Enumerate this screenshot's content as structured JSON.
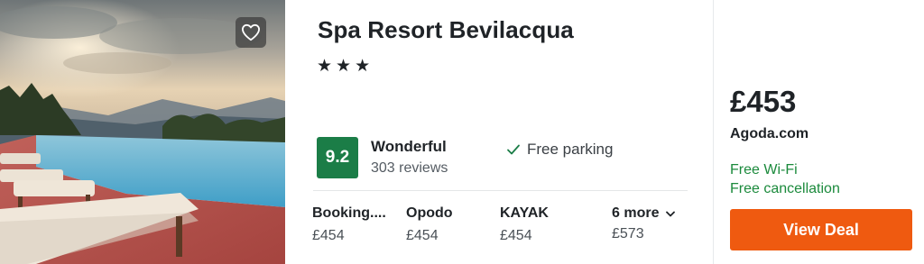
{
  "hotel": {
    "name": "Spa Resort Bevilacqua",
    "stars": "★★★",
    "score": "9.2",
    "rating_word": "Wonderful",
    "reviews": "303 reviews",
    "amenity": "Free parking"
  },
  "partners": [
    {
      "name": "Booking....",
      "price": "£454"
    },
    {
      "name": "Opodo",
      "price": "£454"
    },
    {
      "name": "KAYAK",
      "price": "£454"
    }
  ],
  "more": {
    "label": "6 more",
    "price": "£573"
  },
  "deal": {
    "price": "£453",
    "provider": "Agoda.com",
    "perks": [
      "Free Wi-Fi",
      "Free cancellation"
    ],
    "cta": "View Deal"
  },
  "colors": {
    "score_bg": "#1b7d47",
    "perk_text": "#1b8a3c",
    "cta_bg": "#ef5a10"
  },
  "icons": {
    "favorite": "heart-icon",
    "amenity": "check-icon",
    "expand": "chevron-down-icon"
  }
}
